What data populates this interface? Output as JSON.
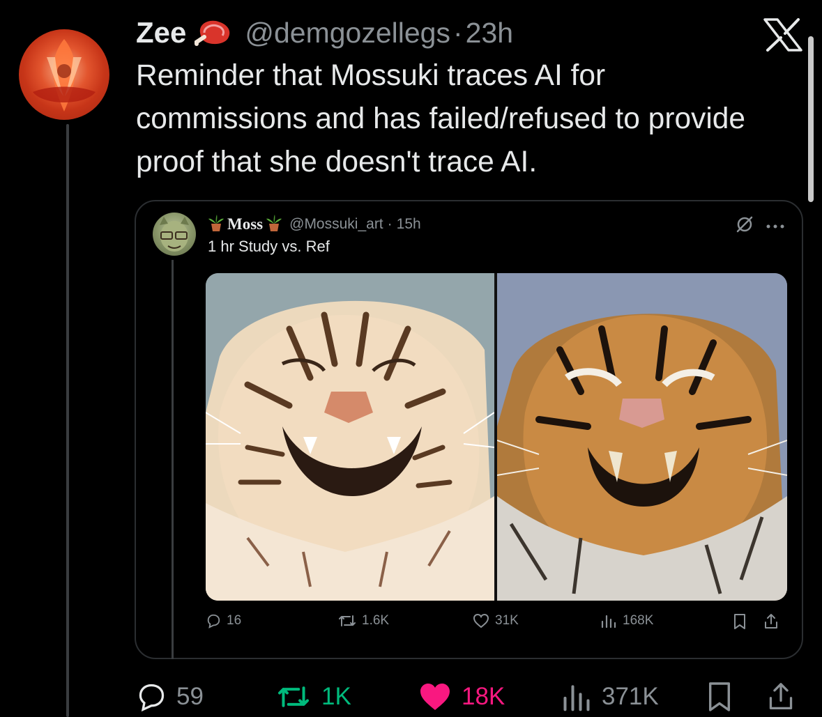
{
  "tweet": {
    "author_name": "Zee",
    "name_emoji": "meat-icon",
    "handle": "@demgozellegs",
    "separator": "·",
    "time": "23h",
    "text": "Reminder that Mossuki traces AI for commissions and has failed/refused to provide proof that she doesn't trace AI."
  },
  "quoted": {
    "author_name": "Moss",
    "name_emoji": "potted-plant-icon",
    "handle": "@Mossuki_art",
    "separator": "·",
    "time": "15h",
    "text": "1 hr Study vs. Ref",
    "media": [
      "tiger-drawing-study",
      "tiger-reference-photo"
    ],
    "actions": {
      "replies": "16",
      "reposts": "1.6K",
      "likes": "31K",
      "views": "168K"
    }
  },
  "actions": {
    "replies": "59",
    "reposts": "1K",
    "likes": "18K",
    "views": "371K"
  },
  "colors": {
    "background": "#000000",
    "text": "#e7e9ea",
    "muted": "#8b9196",
    "repost_green": "#00ba7c",
    "like_pink": "#f91880"
  }
}
